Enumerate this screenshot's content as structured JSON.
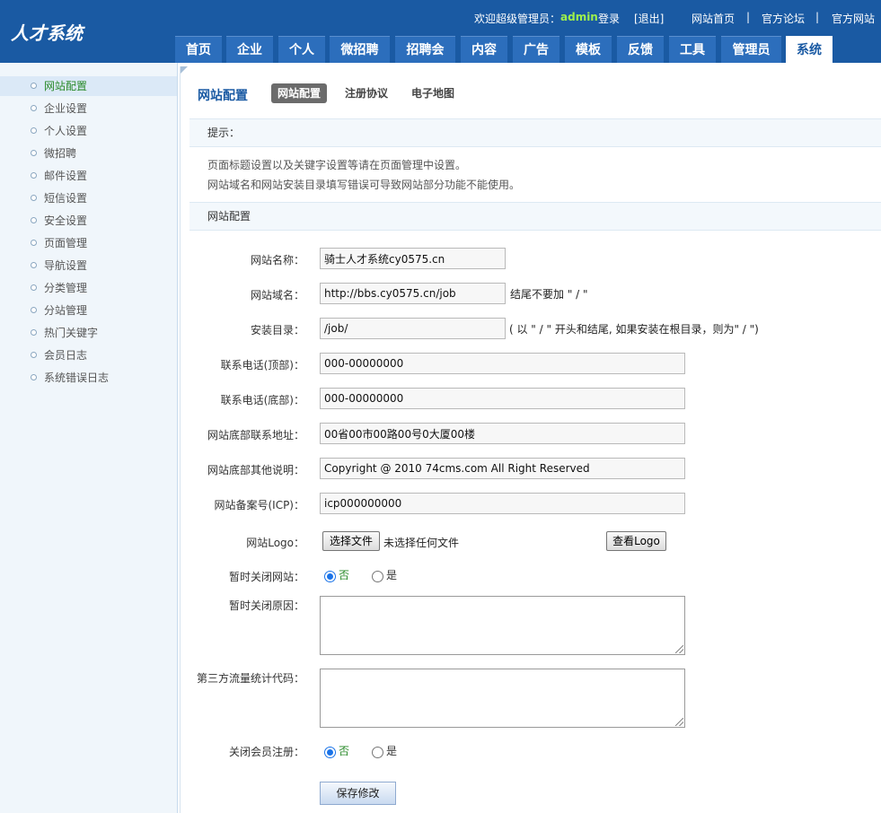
{
  "header": {
    "logo": "人才系统",
    "welcome": "欢迎超级管理员：",
    "username": "admin",
    "login": "登录",
    "logout": "[退出]",
    "links": [
      "网站首页",
      "|",
      "官方论坛",
      "|",
      "官方网站"
    ]
  },
  "nav": {
    "tabs": [
      "首页",
      "企业",
      "个人",
      "微招聘",
      "招聘会",
      "内容",
      "广告",
      "模板",
      "反馈",
      "工具",
      "管理员",
      "系统"
    ],
    "active": "系统"
  },
  "sidebar": {
    "items": [
      "网站配置",
      "企业设置",
      "个人设置",
      "微招聘",
      "邮件设置",
      "短信设置",
      "安全设置",
      "页面管理",
      "导航设置",
      "分类管理",
      "分站管理",
      "热门关键字",
      "会员日志",
      "系统错误日志"
    ],
    "active": "网站配置"
  },
  "content": {
    "title": "网站配置",
    "subtabs": [
      "网站配置",
      "注册协议",
      "电子地图"
    ],
    "tip_header": "提示：",
    "tips": [
      "页面标题设置以及关键字设置等请在页面管理中设置。",
      "网站域名和网站安装目录填写错误可导致网站部分功能不能使用。"
    ],
    "section_header": "网站配置",
    "fields": {
      "site_name": {
        "label": "网站名称：",
        "value": "骑士人才系统cy0575.cn"
      },
      "site_domain": {
        "label": "网站域名：",
        "value": "http://bbs.cy0575.cn/job",
        "hint": "结尾不要加 \" / \""
      },
      "install_dir": {
        "label": "安装目录：",
        "value": "/job/",
        "hint": "( 以 \" / \" 开头和结尾, 如果安装在根目录，则为\" / \")"
      },
      "phone_top": {
        "label": "联系电话(顶部)：",
        "value": "000-00000000"
      },
      "phone_bottom": {
        "label": "联系电话(底部)：",
        "value": "000-00000000"
      },
      "address": {
        "label": "网站底部联系地址：",
        "value": "00省00市00路00号0大厦00楼"
      },
      "other_info": {
        "label": "网站底部其他说明：",
        "value": "Copyright @ 2010 74cms.com All Right Reserved"
      },
      "icp": {
        "label": "网站备案号(ICP)：",
        "value": "icp000000000"
      },
      "logo": {
        "label": "网站Logo：",
        "choose_btn": "选择文件",
        "no_file": "未选择任何文件",
        "view_btn": "查看Logo"
      },
      "close_site": {
        "label": "暂时关闭网站：",
        "opt_no": "否",
        "opt_yes": "是",
        "selected": "否"
      },
      "close_reason": {
        "label": "暂时关闭原因：",
        "value": ""
      },
      "stats_code": {
        "label": "第三方流量统计代码：",
        "value": ""
      },
      "close_register": {
        "label": "关闭会员注册：",
        "opt_no": "否",
        "opt_yes": "是",
        "selected": "否"
      }
    },
    "save_btn": "保存修改"
  }
}
